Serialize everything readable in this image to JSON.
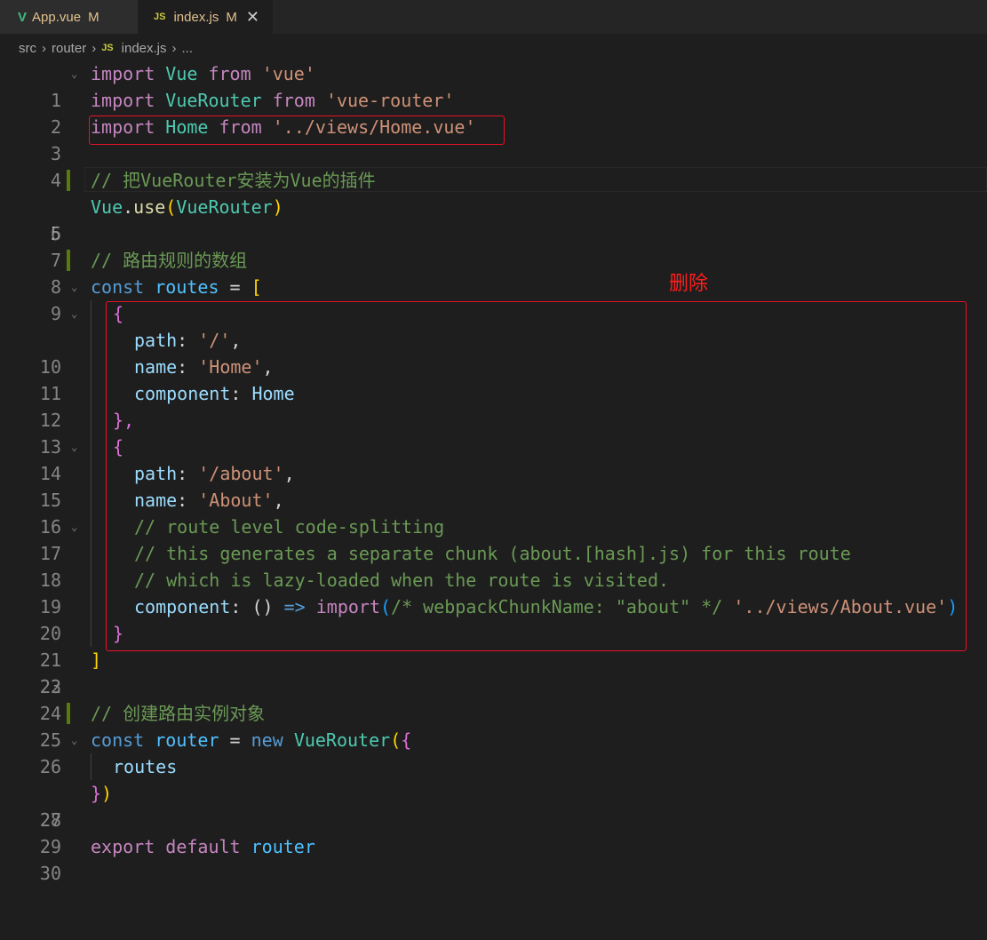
{
  "tabs": [
    {
      "icon": "V",
      "name": "App.vue",
      "status": "M"
    },
    {
      "icon": "JS",
      "name": "index.js",
      "status": "M",
      "close": "✕"
    }
  ],
  "breadcrumb": [
    "src",
    "router",
    "index.js",
    "..."
  ],
  "breadcrumb_file_icon": "JS",
  "annotation": {
    "delete_label": "删除",
    "color": "#e81123"
  },
  "line_numbers": [
    "1",
    "2",
    "3",
    "4",
    "5",
    "6",
    "7",
    "8",
    "9",
    "10",
    "11",
    "12",
    "13",
    "14",
    "15",
    "16",
    "17",
    "18",
    "19",
    "20",
    "21",
    "22",
    "23",
    "24",
    "25",
    "26",
    "27",
    "28",
    "29",
    "30"
  ],
  "code": {
    "l1": [
      "import",
      "Vue",
      "from",
      "'vue'"
    ],
    "l2": [
      "import",
      "VueRouter",
      "from",
      "'vue-router'"
    ],
    "l3": [
      "import",
      "Home",
      "from",
      "'../views/Home.vue'"
    ],
    "l5": "// 把VueRouter安装为Vue的插件",
    "l6": [
      "Vue",
      ".",
      "use",
      "(",
      "VueRouter",
      ")"
    ],
    "l8": "// 路由规则的数组",
    "l9": [
      "const",
      "routes",
      " = ",
      "["
    ],
    "l10": "{",
    "l11": [
      "path",
      ": ",
      "'/'",
      ","
    ],
    "l12": [
      "name",
      ": ",
      "'Home'",
      ","
    ],
    "l13": [
      "component",
      ": ",
      "Home"
    ],
    "l14": "},",
    "l15": "{",
    "l16": [
      "path",
      ": ",
      "'/about'",
      ","
    ],
    "l17": [
      "name",
      ": ",
      "'About'",
      ","
    ],
    "l18": "// route level code-splitting",
    "l19": "// this generates a separate chunk (about.[hash].js) for this route",
    "l20": "// which is lazy-loaded when the route is visited.",
    "l21": [
      "component",
      ": ",
      "() ",
      "=>",
      " ",
      "import",
      "(",
      "/* webpackChunkName: \"about\" */",
      " ",
      "'../views/About.vue'",
      ")"
    ],
    "l22": "}",
    "l23": "]",
    "l25": "// 创建路由实例对象",
    "l26": [
      "const",
      "router",
      " = ",
      "new",
      "VueRouter",
      "(",
      "{"
    ],
    "l27": "routes",
    "l28": [
      "}",
      ")"
    ],
    "l30": [
      "export",
      "default",
      "router"
    ]
  },
  "colors": {
    "keyword": "#c586c0",
    "storage": "#569cd6",
    "variable": "#9cdcfe",
    "class": "#4ec9b0",
    "function": "#dcdcaa",
    "string": "#ce9178",
    "comment": "#6a9955",
    "background": "#1e1e1e"
  }
}
